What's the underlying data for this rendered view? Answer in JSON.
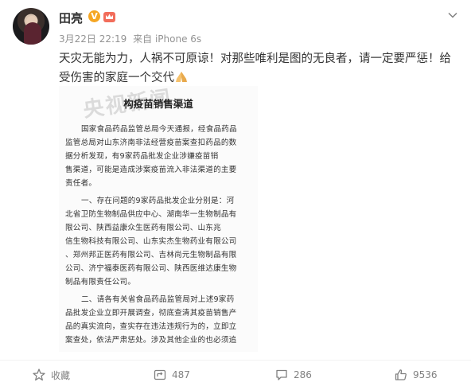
{
  "user": {
    "name": "田亮",
    "verified_badge": "V"
  },
  "meta": {
    "time": "3月22日 22:19",
    "source": "来自 iPhone 6s"
  },
  "post": {
    "text": "天灾无能为力，人祸不可原谅！对那些唯利是图的无良者，请一定要严惩！给受伤害的家庭一个交代"
  },
  "document": {
    "watermark": "央视新闻",
    "title": "构疫苗销售渠道",
    "paragraphs": [
      "国家食品药品监管总局今天通报，经食品药品",
      "监管总局对山东济南非法经营疫苗案查扣药品的数",
      "据分析发现，有9家药品批发企业涉嫌疫苗销",
      "售渠道，可能是造成涉案疫苗流入非法渠道的主要",
      "责任者。",
      "一、存在问题的9家药品批发企业分别是：河",
      "北省卫防生物制品供应中心、湖南华一生物制品有",
      "限公司、陕西益康众生医药有限公司、山东兆",
      "信生物科技有限公司、山东实杰生物药业有限公司",
      "、郑州邦正医药有限公司、吉林尚元生物制品有限",
      "公司、济宁福泰医药有限公司、陕西医维达康生物",
      "制品有限责任公司。",
      "二、请各有关省食品药品监管局对上述9家药",
      "品批发企业立即开展调查，彻底查清其疫苗销售产",
      "品的真实流向，查实存在违法违规行为的，立即立",
      "案查处，依法严肃惩处。涉及其他企业的也必须追"
    ]
  },
  "actions": {
    "favorite": "收藏",
    "repost_count": "487",
    "comment_count": "286",
    "like_count": "9536"
  },
  "icons": [
    "star-icon",
    "repost-icon",
    "comment-icon",
    "like-icon",
    "chevron-down-icon",
    "pray-hands-icon",
    "crown-badge-icon"
  ],
  "colors": {
    "verified": "#f5a623",
    "meta_text": "#939393",
    "action_text": "#808080"
  }
}
